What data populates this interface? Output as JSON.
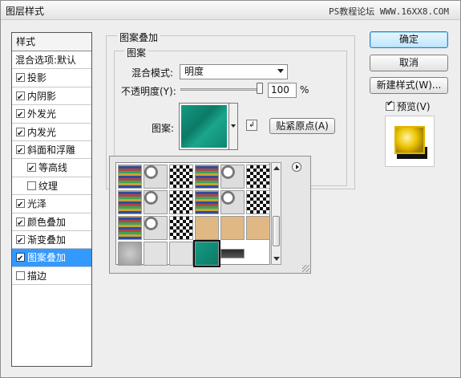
{
  "window": {
    "title": "图层样式",
    "watermark": "PS教程论坛 WWW.16XX8.COM"
  },
  "sidebar": {
    "header": "样式",
    "blend_label": "混合选项:默认",
    "items": [
      {
        "label": "投影",
        "checked": true
      },
      {
        "label": "内阴影",
        "checked": true
      },
      {
        "label": "外发光",
        "checked": true
      },
      {
        "label": "内发光",
        "checked": true
      },
      {
        "label": "斜面和浮雕",
        "checked": true
      },
      {
        "label": "等高线",
        "checked": true,
        "indent": true
      },
      {
        "label": "纹理",
        "checked": false,
        "indent": true
      },
      {
        "label": "光泽",
        "checked": true
      },
      {
        "label": "颜色叠加",
        "checked": true
      },
      {
        "label": "渐变叠加",
        "checked": true
      },
      {
        "label": "图案叠加",
        "checked": true,
        "selected": true
      },
      {
        "label": "描边",
        "checked": false
      }
    ]
  },
  "panel": {
    "group_title": "图案叠加",
    "subgroup_title": "图案",
    "blend_mode_label": "混合模式:",
    "blend_mode_value": "明度",
    "opacity_label": "不透明度(Y):",
    "opacity_value": "100",
    "opacity_unit": "%",
    "opacity_fraction": 1.0,
    "pattern_label": "图案:",
    "snap_button": "贴紧原点(A)"
  },
  "buttons": {
    "ok": "确定",
    "cancel": "取消",
    "new_style": "新建样式(W)...",
    "preview": "预览(V)",
    "preview_checked": true
  },
  "picker": {
    "tiles": [
      "rainbow-weave",
      "gray-mottle",
      "checker",
      "rainbow-weave",
      "gray-mottle",
      "checker",
      "rainbow-weave",
      "gray-mottle",
      "checker",
      "rainbow-weave",
      "gray-mottle",
      "checker",
      "rainbow-weave",
      "gray-mottle",
      "checker",
      "tan",
      "tan",
      "tan",
      "gray-stone",
      "light-gray",
      "light-gray",
      "teal-selected",
      "dark-stone"
    ]
  },
  "colors": {
    "accent": "#3399ff",
    "swatch": "#159a83"
  }
}
